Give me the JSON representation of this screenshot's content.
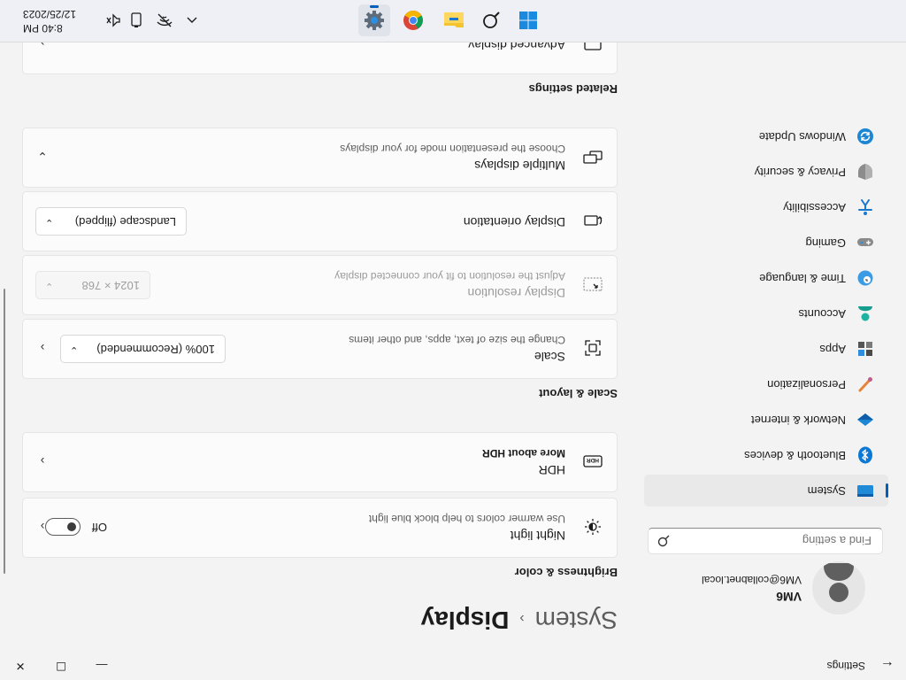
{
  "window": {
    "app_title": "Settings",
    "back_glyph": "←",
    "minimize_glyph": "—",
    "maximize_glyph": "☐",
    "close_glyph": "✕"
  },
  "user": {
    "name": "VM6",
    "email": "VM6@collabnet.local"
  },
  "search": {
    "placeholder": "Find a setting",
    "icon": "search-icon"
  },
  "sidebar": {
    "items": [
      {
        "label": "System",
        "icon": "system-icon",
        "selected": true
      },
      {
        "label": "Bluetooth & devices",
        "icon": "bluetooth-icon"
      },
      {
        "label": "Network & internet",
        "icon": "network-icon"
      },
      {
        "label": "Personalization",
        "icon": "brush-icon"
      },
      {
        "label": "Apps",
        "icon": "apps-icon"
      },
      {
        "label": "Accounts",
        "icon": "accounts-icon"
      },
      {
        "label": "Time & language",
        "icon": "globe-clock-icon"
      },
      {
        "label": "Gaming",
        "icon": "gamepad-icon"
      },
      {
        "label": "Accessibility",
        "icon": "accessibility-icon"
      },
      {
        "label": "Privacy & security",
        "icon": "shield-icon"
      },
      {
        "label": "Windows Update",
        "icon": "update-icon"
      }
    ]
  },
  "breadcrumb": {
    "parent": "System",
    "separator": "›",
    "current": "Display"
  },
  "sections": {
    "brightness": "Brightness & color",
    "scale_layout": "Scale & layout",
    "related": "Related settings"
  },
  "night_light": {
    "title": "Night light",
    "desc": "Use warmer colors to help block blue light",
    "state": "Off"
  },
  "hdr": {
    "title": "HDR",
    "link": "More about HDR"
  },
  "scale": {
    "title": "Scale",
    "desc": "Change the size of text, apps, and other items",
    "value": "100% (Recommended)"
  },
  "resolution": {
    "title": "Display resolution",
    "desc": "Adjust the resolution to fit your connected display",
    "value": "1024 × 768",
    "disabled": true
  },
  "orientation": {
    "title": "Display orientation",
    "value": "Landscape (flipped)"
  },
  "multiple_displays": {
    "title": "Multiple displays",
    "desc": "Choose the presentation mode for your displays"
  },
  "advanced_display": {
    "title": "Advanced display"
  },
  "taskbar": {
    "apps": [
      "windows-start-icon",
      "search-icon",
      "file-explorer-icon",
      "chrome-icon",
      "settings-gear-icon"
    ],
    "time": "8:40 PM",
    "date": "12/25/2023"
  },
  "colors": {
    "accent": "#005fb8",
    "background": "#f3f3f3",
    "card": "#fbfbfb"
  }
}
